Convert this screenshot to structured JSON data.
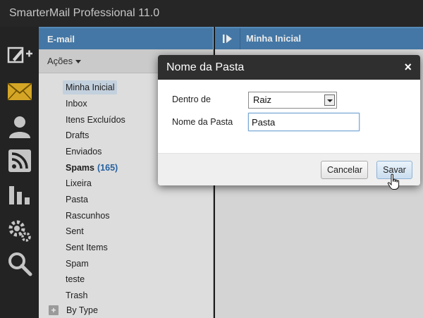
{
  "app": {
    "title": "SmarterMail Professional 11.0"
  },
  "nav": [
    {
      "name": "compose-icon"
    },
    {
      "name": "mail-icon"
    },
    {
      "name": "contacts-icon"
    },
    {
      "name": "rss-icon"
    },
    {
      "name": "reports-icon"
    },
    {
      "name": "settings-icon"
    },
    {
      "name": "search-icon"
    }
  ],
  "email_panel": {
    "header": "E-mail",
    "actions_label": "Ações",
    "folders": [
      {
        "label": "Minha Inicial",
        "selected": true
      },
      {
        "label": "Inbox"
      },
      {
        "label": "Itens Excluídos"
      },
      {
        "label": "Drafts"
      },
      {
        "label": "Enviados"
      },
      {
        "label": "Spams",
        "count": "(165)",
        "bold": true
      },
      {
        "label": "Lixeira"
      },
      {
        "label": "Pasta"
      },
      {
        "label": "Rascunhos"
      },
      {
        "label": "Sent"
      },
      {
        "label": "Sent Items"
      },
      {
        "label": "Spam"
      },
      {
        "label": "teste"
      },
      {
        "label": "Trash"
      }
    ],
    "by_type_toggle": "+",
    "by_type_label": "By Type"
  },
  "main_panel": {
    "header": "Minha Inicial"
  },
  "dialog": {
    "title": "Nome da Pasta",
    "close": "×",
    "parent_label": "Dentro de",
    "parent_value": "Raiz",
    "name_label": "Nome da Pasta",
    "name_value": "Pasta",
    "cancel_label": "Cancelar",
    "save_label": "Savar"
  },
  "colors": {
    "header_blue": "#4a82b4",
    "dark": "#2a2a2a",
    "mail_icon": "#e8b52a",
    "link_count": "#2a6aae"
  }
}
